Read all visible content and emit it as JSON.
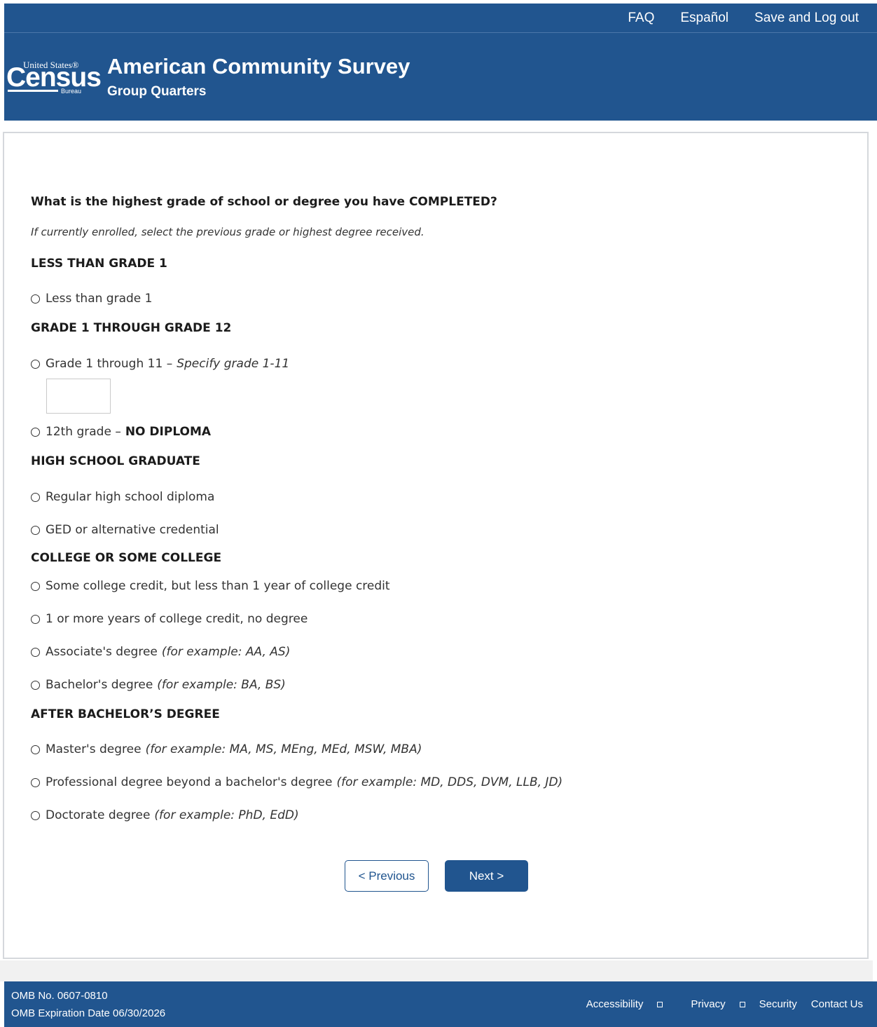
{
  "topnav": {
    "faq": "FAQ",
    "espanol": "Español",
    "logout": "Save and Log out"
  },
  "brand": {
    "logo_us": "United States®",
    "logo_census": "Census",
    "logo_bureau": "Bureau",
    "title": "American Community Survey",
    "subtitle": "Group Quarters"
  },
  "form": {
    "question": "What is the highest grade of school or degree you have COMPLETED?",
    "instruction": "If currently enrolled, select the previous grade or highest degree received.",
    "sections": {
      "s1": "LESS THAN GRADE 1",
      "s2": "GRADE 1 THROUGH GRADE 12",
      "s3": "HIGH SCHOOL GRADUATE",
      "s4": "COLLEGE OR SOME COLLEGE",
      "s5": "AFTER BACHELOR’S DEGREE"
    },
    "options": {
      "less_grade1": "Less than grade 1",
      "grade1_11": "Grade 1 through 11 –",
      "grade1_11_ex": "Specify grade 1-11",
      "grade12": "12th grade –",
      "grade12_bold": "NO DIPLOMA",
      "hs_diploma": "Regular high school diploma",
      "ged": "GED or alternative credential",
      "some_college": "Some college credit, but less than 1 year of college credit",
      "one_year": "1 or more years of college credit, no degree",
      "associate": "Associate's degree",
      "associate_ex": "(for example: AA, AS)",
      "bachelor": "Bachelor's degree",
      "bachelor_ex": "(for example: BA, BS)",
      "master": "Master's degree",
      "master_ex": "(for example: MA, MS, MEng, MEd, MSW, MBA)",
      "professional": "Professional degree beyond a bachelor's degree",
      "professional_ex": "(for example: MD, DDS, DVM, LLB, JD)",
      "doctorate": "Doctorate degree",
      "doctorate_ex": "(for example: PhD, EdD)"
    },
    "prev_label": "< Previous",
    "next_label": "Next >"
  },
  "footer": {
    "omb_no": "OMB No. 0607-0810",
    "omb_exp": "OMB Expiration Date 06/30/2026",
    "accessibility": "Accessibility",
    "privacy": "Privacy",
    "security": "Security",
    "contact": "Contact Us"
  }
}
